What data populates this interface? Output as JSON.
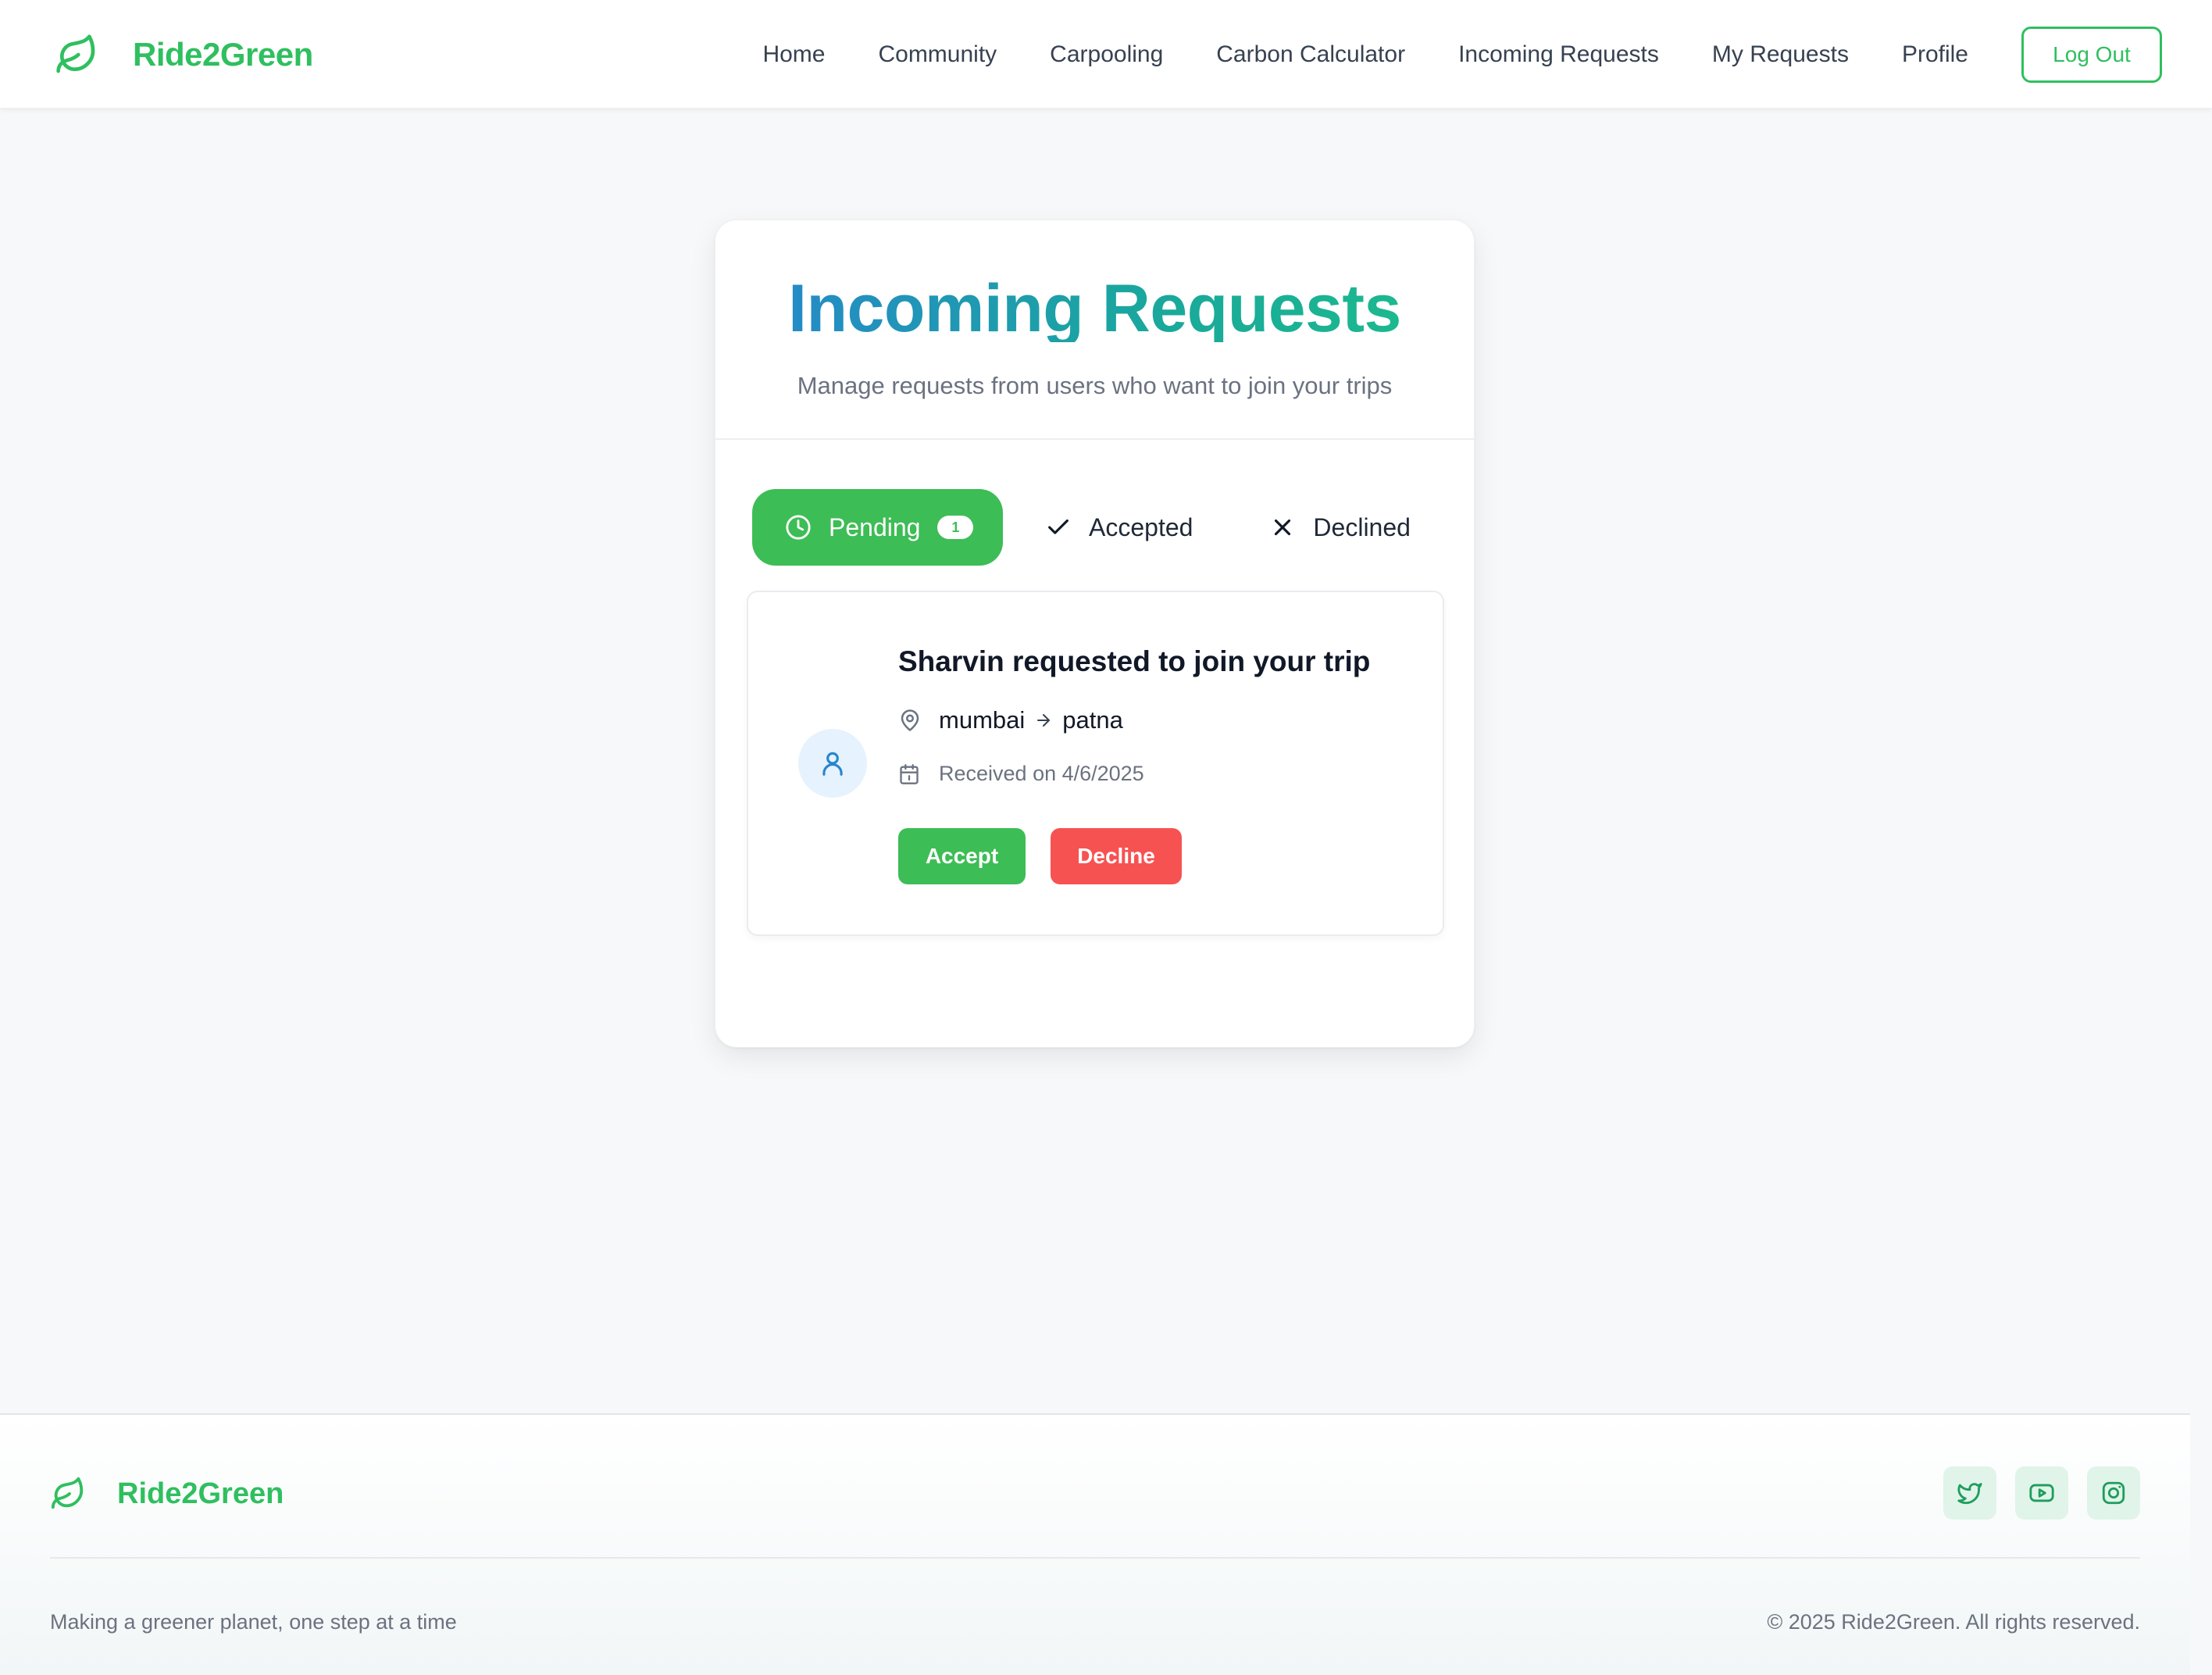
{
  "brand": {
    "name": "Ride2Green",
    "color": "#2fbf5f",
    "icon": "leaf-icon"
  },
  "nav": {
    "items": [
      "Home",
      "Community",
      "Carpooling",
      "Carbon Calculator",
      "Incoming Requests",
      "My Requests",
      "Profile"
    ],
    "logout_label": "Log Out"
  },
  "page": {
    "title": "Incoming Requests",
    "subtitle": "Manage requests from users who want to join your trips"
  },
  "tabs": {
    "pending": {
      "label": "Pending",
      "count": "1",
      "icon": "clock-icon",
      "active": true
    },
    "accepted": {
      "label": "Accepted",
      "icon": "check-icon"
    },
    "declined": {
      "label": "Declined",
      "icon": "x-icon"
    }
  },
  "requests": [
    {
      "title": "Sharvin requested to join your trip",
      "from": "mumbai",
      "to": "patna",
      "received": "Received on 4/6/2025",
      "accept_label": "Accept",
      "decline_label": "Decline"
    }
  ],
  "footer": {
    "brand_name": "Ride2Green",
    "tagline": "Making a greener planet, one step at a time",
    "copyright": "© 2025 Ride2Green. All rights reserved.",
    "socials": [
      "twitter-icon",
      "youtube-icon",
      "instagram-icon"
    ]
  },
  "colors": {
    "accent_green": "#3dbd55",
    "decline_red": "#f75252",
    "title_gradient_start": "#2786cf",
    "title_gradient_end": "#1dbd8b"
  }
}
